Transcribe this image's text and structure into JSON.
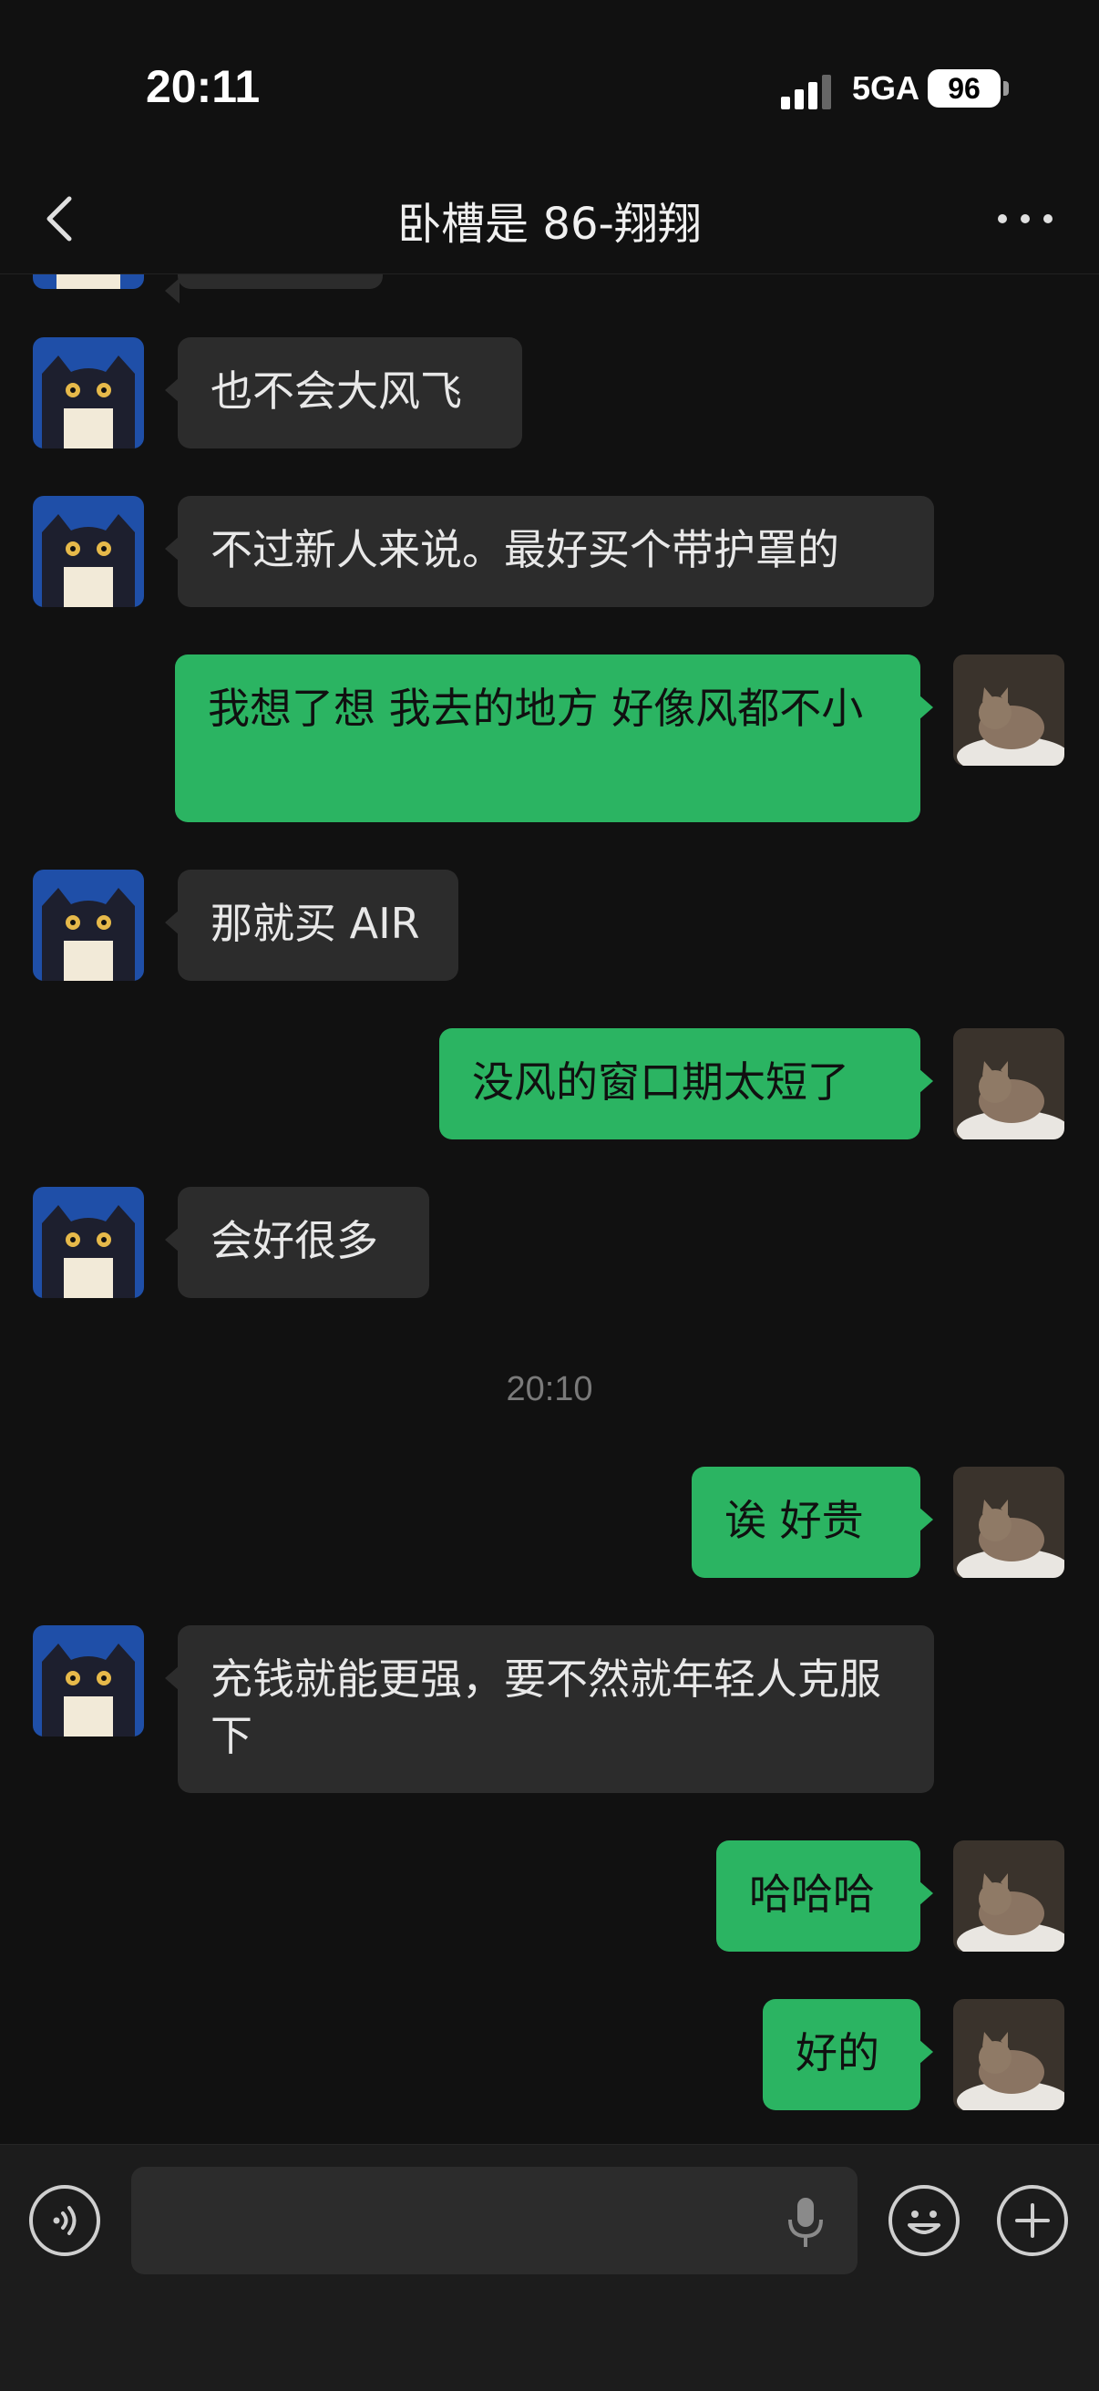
{
  "status_bar": {
    "time": "20:11",
    "network": "5GA",
    "battery": "96"
  },
  "header": {
    "title": "卧槽是 86-翔翔"
  },
  "messages": [
    {
      "side": "in",
      "text": "也不会大风飞"
    },
    {
      "side": "in",
      "text": "不过新人来说。最好买个带护罩的"
    },
    {
      "side": "out",
      "text": "我想了想  我去的地方 好像风都不小"
    },
    {
      "side": "in",
      "text": "那就买 AIR"
    },
    {
      "side": "out",
      "text": "没风的窗口期太短了"
    },
    {
      "side": "in",
      "text": "会好很多"
    },
    {
      "side": "out",
      "text": "诶  好贵"
    },
    {
      "side": "in",
      "text": "充钱就能更强，要不然就年轻人克服下"
    },
    {
      "side": "out",
      "text": "哈哈哈"
    },
    {
      "side": "out",
      "text": "好的"
    }
  ],
  "timestamp": "20:10",
  "input": {
    "value": ""
  },
  "icons": {
    "back": "chevron-left-icon",
    "more": "more-dots-icon",
    "voice": "voice-icon",
    "mic": "mic-icon",
    "emoji": "emoji-icon",
    "plus": "plus-icon"
  },
  "colors": {
    "background": "#111111",
    "incoming_bubble": "#2c2c2c",
    "outgoing_bubble": "#2bb462"
  }
}
